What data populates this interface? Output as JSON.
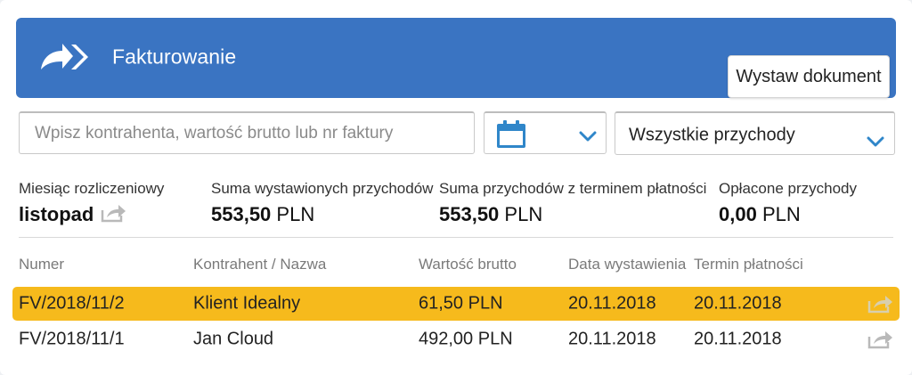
{
  "header": {
    "title": "Fakturowanie",
    "issue_button": "Wystaw dokument",
    "bg_color": "#3a74c2"
  },
  "filters": {
    "search_placeholder": "Wpisz kontrahenta, wartość brutto lub nr faktury",
    "search_value": "",
    "date_icon": "calendar-icon",
    "income_type": "Wszystkie przychody"
  },
  "summary": {
    "month_label": "Miesiąc rozliczeniowy",
    "month_value": "listopad",
    "issued_label": "Suma wystawionych przychodów",
    "issued_amount": "553,50",
    "issued_currency": "PLN",
    "due_label": "Suma przychodów z terminem płatności",
    "due_amount": "553,50",
    "due_currency": "PLN",
    "paid_label": "Opłacone przychody",
    "paid_amount": "0,00",
    "paid_currency": "PLN"
  },
  "table": {
    "columns": [
      "Numer",
      "Kontrahent / Nazwa",
      "Wartość brutto",
      "Data wystawienia",
      "Termin płatności"
    ],
    "rows": [
      {
        "number": "FV/2018/11/2",
        "contractor": "Klient Idealny",
        "gross": "61,50 PLN",
        "issue_date": "20.11.2018",
        "due_date": "20.11.2018",
        "selected": true
      },
      {
        "number": "FV/2018/11/1",
        "contractor": "Jan Cloud",
        "gross": "492,00 PLN",
        "issue_date": "20.11.2018",
        "due_date": "20.11.2018",
        "selected": false
      }
    ],
    "selected_row_color": "#f6ba1c"
  },
  "colors": {
    "accent": "#3a74c2",
    "chevron": "#2f86c9"
  }
}
